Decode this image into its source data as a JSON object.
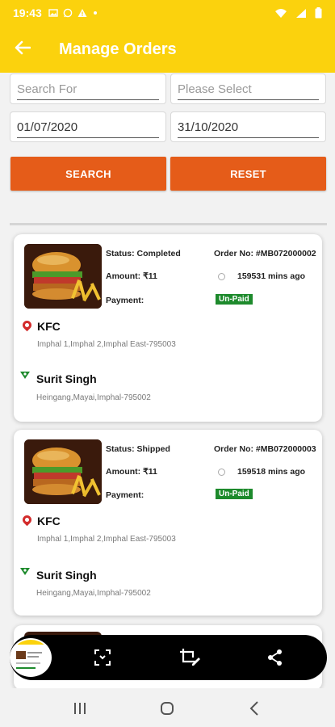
{
  "status_bar": {
    "time": "19:43",
    "icons": [
      "image-icon",
      "whatsapp-icon",
      "warning-icon",
      "dot-icon"
    ],
    "right_icons": [
      "wifi-icon",
      "signal-icon",
      "battery-icon"
    ]
  },
  "app_bar": {
    "title": "Manage Orders"
  },
  "filters": {
    "search_placeholder": "Search For",
    "select_placeholder": "Please Select",
    "date_from": "01/07/2020",
    "date_to": "31/10/2020",
    "search_button": "SEARCH",
    "reset_button": "RESET"
  },
  "orders": [
    {
      "status": "Status: Completed",
      "order_no": "Order No: #MB072000002",
      "amount": "Amount: ₹11",
      "ago": "159531 mins ago",
      "payment_label": "Payment:",
      "payment_status": "Un-Paid",
      "vendor_name": "KFC",
      "vendor_address": "Imphal 1,Imphal 2,Imphal East-795003",
      "customer_name": "Surit Singh",
      "customer_address": "Heingang,Mayai,Imphal-795002"
    },
    {
      "status": "Status: Shipped",
      "order_no": "Order No: #MB072000003",
      "amount": "Amount: ₹11",
      "ago": "159518 mins ago",
      "payment_label": "Payment:",
      "payment_status": "Un-Paid",
      "vendor_name": "KFC",
      "vendor_address": "Imphal 1,Imphal 2,Imphal East-795003",
      "customer_name": "Surit Singh",
      "customer_address": "Heingang,Mayai,Imphal-795002"
    }
  ],
  "colors": {
    "accent": "#fbd20d",
    "button": "#e55c19",
    "paid_badge": "#1d8a2c",
    "pin_vendor": "#d32c2c",
    "pin_customer": "#1d8a2c"
  },
  "screenshot_toolbar": {
    "icons": [
      "scroll-capture-icon",
      "crop-edit-icon",
      "share-icon"
    ]
  },
  "nav_bar": {
    "icons": [
      "recents-icon",
      "home-icon",
      "back-icon"
    ]
  }
}
